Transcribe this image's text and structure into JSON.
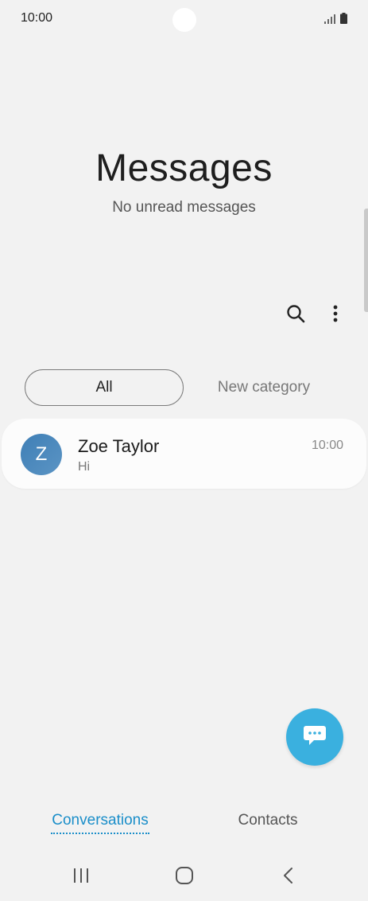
{
  "status_bar": {
    "time": "10:00",
    "signal_icon": "signal-icon",
    "battery_icon": "battery-icon"
  },
  "header": {
    "title": "Messages",
    "subtitle": "No unread messages"
  },
  "toolbar": {
    "search_icon": "search-icon",
    "more_icon": "more-vertical-icon"
  },
  "categories": {
    "all_label": "All",
    "new_category_label": "New category"
  },
  "conversations": [
    {
      "avatar_letter": "Z",
      "name": "Zoe Taylor",
      "preview": "Hi",
      "time": "10:00"
    }
  ],
  "fab": {
    "icon": "compose-message-icon"
  },
  "bottom_nav": {
    "conversations_label": "Conversations",
    "contacts_label": "Contacts"
  },
  "system_nav": {
    "recents_icon": "recents-icon",
    "home_icon": "home-icon",
    "back_icon": "back-icon"
  },
  "colors": {
    "accent": "#1a8ec9",
    "fab": "#3ab0df",
    "avatar": "#3f7fb6",
    "background": "#f2f2f2"
  }
}
